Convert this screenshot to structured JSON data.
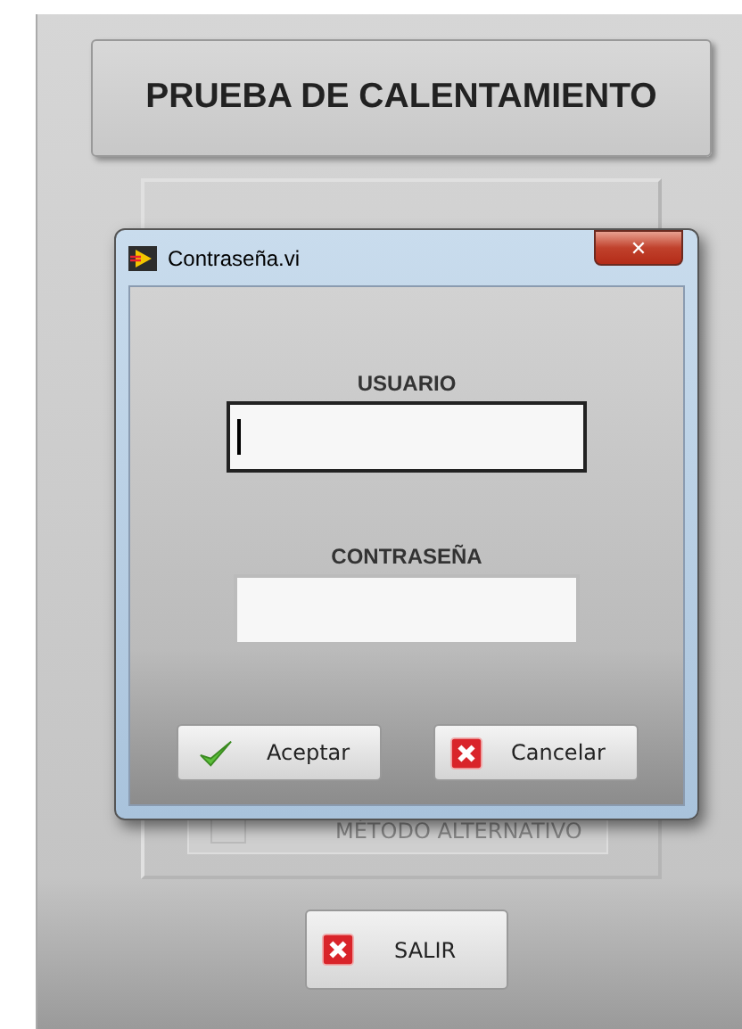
{
  "panel": {
    "title_button": "PRUEBA DE CALENTAMIENTO",
    "option": {
      "label": "MÉTODO ALTERNATIVO",
      "checked": false,
      "disabled": true
    },
    "exit_button": {
      "label": "SALIR",
      "kind": "cancel"
    }
  },
  "dialog": {
    "title": "Contraseña.vi",
    "close_glyph": "✕",
    "fields": [
      {
        "label": "USUARIO",
        "focused": true
      },
      {
        "label": "CONTRASEÑA",
        "focused": false
      }
    ],
    "buttons": [
      {
        "label": "Aceptar",
        "kind": "accept"
      },
      {
        "label": "Cancelar",
        "kind": "cancel"
      }
    ]
  }
}
